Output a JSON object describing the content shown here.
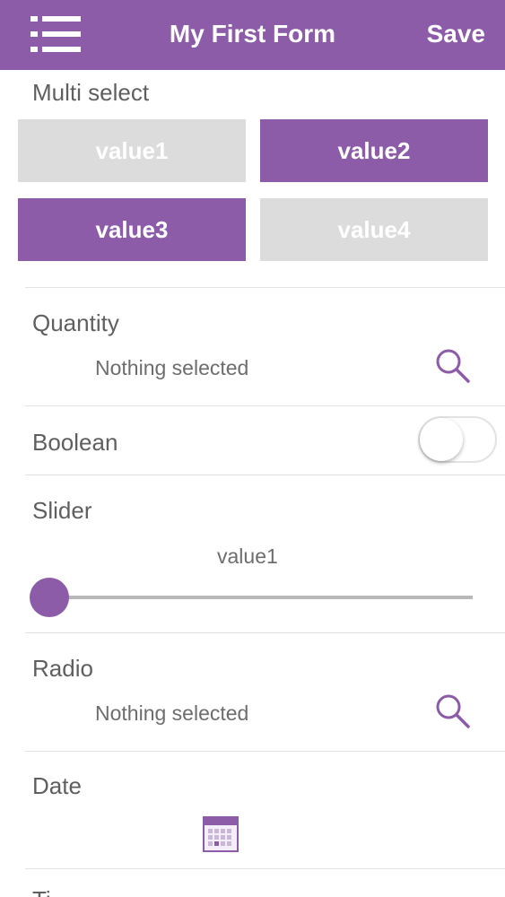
{
  "header": {
    "title": "My First Form",
    "save_label": "Save",
    "menu_icon": "menu-list-icon"
  },
  "multi_select": {
    "label": "Multi select",
    "options": [
      {
        "label": "value1",
        "selected": false
      },
      {
        "label": "value2",
        "selected": true
      },
      {
        "label": "value3",
        "selected": true
      },
      {
        "label": "value4",
        "selected": false
      }
    ]
  },
  "quantity": {
    "label": "Quantity",
    "value": "Nothing selected",
    "icon": "search-icon"
  },
  "boolean": {
    "label": "Boolean",
    "checked": false
  },
  "slider": {
    "label": "Slider",
    "value": "value1",
    "position": 0
  },
  "radio": {
    "label": "Radio",
    "value": "Nothing selected",
    "icon": "search-icon"
  },
  "date": {
    "label": "Date",
    "icon": "calendar-icon"
  },
  "next_section": {
    "label": "Ti"
  },
  "colors": {
    "accent": "#8c5ca8",
    "chip_off": "#dcdcdc",
    "text": "#5f5f5f"
  }
}
